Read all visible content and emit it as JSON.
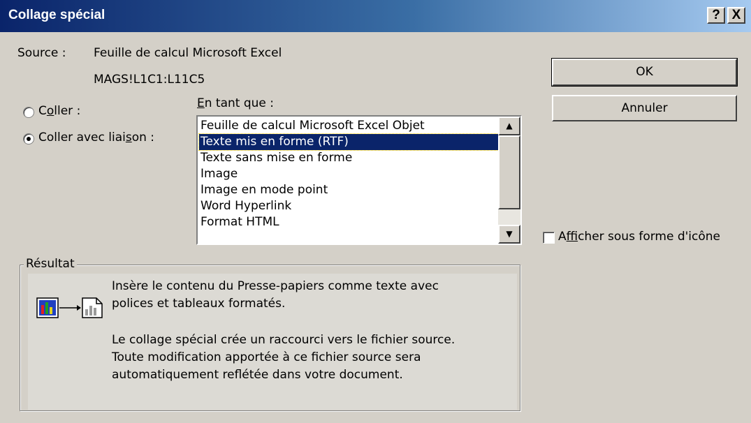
{
  "window": {
    "title": "Collage spécial",
    "help_button": "?",
    "close_button": "X"
  },
  "source": {
    "label": "Source :",
    "value": "Feuille de calcul Microsoft Excel",
    "range": "MAGS!L1C1:L11C5"
  },
  "paste_options": {
    "coller": {
      "pre": "C",
      "accel": "o",
      "post": "ller :",
      "selected": false
    },
    "coller_liaison": {
      "pre": "Coller avec liai",
      "accel": "s",
      "post": "on :",
      "selected": true
    }
  },
  "as_label": {
    "accel": "E",
    "post": "n tant que :"
  },
  "as_list": {
    "items": [
      "Feuille de calcul Microsoft Excel Objet",
      "Texte mis en forme (RTF)",
      "Texte sans mise en forme",
      "Image",
      "Image en mode point",
      "Word Hyperlink",
      "Format HTML"
    ],
    "selected_index": 1
  },
  "buttons": {
    "ok": "OK",
    "cancel": "Annuler"
  },
  "display_as_icon": {
    "pre": "A",
    "accel": "f",
    "post": "ficher sous forme d'icône",
    "checked": false
  },
  "result": {
    "legend": "Résultat",
    "line1": "Insère le contenu du Presse-papiers comme texte avec",
    "line2": "polices et tableaux formatés.",
    "line3": "Le collage spécial crée un raccourci vers le fichier source.",
    "line4": "Toute modification apportée à ce fichier source sera",
    "line5": "automatiquement reflétée dans votre document.",
    "icon": "paste-link-icon"
  }
}
